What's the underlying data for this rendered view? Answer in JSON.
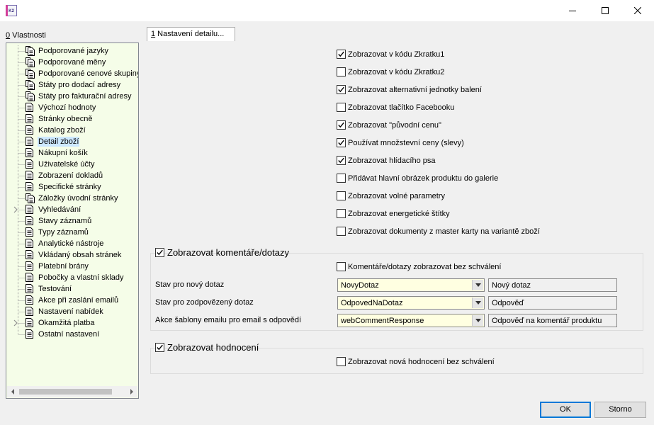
{
  "window": {
    "app_icon_text": "K2",
    "minimize_icon": "minimize-icon",
    "maximize_icon": "maximize-icon",
    "close_icon": "close-icon"
  },
  "left_panel": {
    "hotkey": "0",
    "title": " Vlastnosti",
    "items": [
      {
        "label": "Podporované jazyky",
        "icon": "multi-doc-icon",
        "expandable": false,
        "selected": false
      },
      {
        "label": "Podporované měny",
        "icon": "multi-doc-icon",
        "expandable": false,
        "selected": false
      },
      {
        "label": "Podporované cenové skupiny",
        "icon": "multi-doc-icon",
        "expandable": false,
        "selected": false
      },
      {
        "label": "Státy pro dodací adresy",
        "icon": "multi-doc-icon",
        "expandable": false,
        "selected": false
      },
      {
        "label": "Státy pro fakturační adresy",
        "icon": "multi-doc-icon",
        "expandable": false,
        "selected": false
      },
      {
        "label": "Výchozí hodnoty",
        "icon": "doc-icon",
        "expandable": false,
        "selected": false
      },
      {
        "label": "Stránky obecně",
        "icon": "doc-icon",
        "expandable": false,
        "selected": false
      },
      {
        "label": "Katalog zboží",
        "icon": "doc-icon",
        "expandable": false,
        "selected": false
      },
      {
        "label": "Detail zboží",
        "icon": "doc-icon",
        "expandable": false,
        "selected": true
      },
      {
        "label": "Nákupní košík",
        "icon": "doc-icon",
        "expandable": false,
        "selected": false
      },
      {
        "label": "Uživatelské účty",
        "icon": "doc-icon",
        "expandable": false,
        "selected": false
      },
      {
        "label": "Zobrazení dokladů",
        "icon": "doc-icon",
        "expandable": false,
        "selected": false
      },
      {
        "label": "Specifické stránky",
        "icon": "doc-icon",
        "expandable": false,
        "selected": false
      },
      {
        "label": "Záložky úvodní stránky",
        "icon": "multi-doc-icon",
        "expandable": false,
        "selected": false
      },
      {
        "label": "Vyhledávání",
        "icon": "doc-icon",
        "expandable": true,
        "selected": false
      },
      {
        "label": "Stavy záznamů",
        "icon": "doc-icon",
        "expandable": false,
        "selected": false
      },
      {
        "label": "Typy záznamů",
        "icon": "doc-icon",
        "expandable": false,
        "selected": false
      },
      {
        "label": "Analytické nástroje",
        "icon": "doc-icon",
        "expandable": false,
        "selected": false
      },
      {
        "label": "Vkládaný obsah stránek",
        "icon": "doc-icon",
        "expandable": false,
        "selected": false
      },
      {
        "label": "Platební brány",
        "icon": "doc-icon",
        "expandable": false,
        "selected": false
      },
      {
        "label": "Pobočky a vlastní sklady",
        "icon": "doc-icon",
        "expandable": false,
        "selected": false
      },
      {
        "label": "Testování",
        "icon": "doc-icon",
        "expandable": false,
        "selected": false
      },
      {
        "label": "Akce při zaslání emailů",
        "icon": "doc-icon",
        "expandable": false,
        "selected": false
      },
      {
        "label": "Nastavení nabídek",
        "icon": "doc-icon",
        "expandable": false,
        "selected": false
      },
      {
        "label": "Okamžitá platba",
        "icon": "doc-icon",
        "expandable": true,
        "selected": false
      },
      {
        "label": "Ostatní nastavení",
        "icon": "doc-icon",
        "expandable": false,
        "selected": false
      }
    ]
  },
  "tab": {
    "hotkey": "1",
    "label": " Nastavení detailu..."
  },
  "options": [
    {
      "label": "Zobrazovat v kódu Zkratku1",
      "checked": true
    },
    {
      "label": "Zobrazovat v kódu Zkratku2",
      "checked": false
    },
    {
      "label": "Zobrazovat alternativní jednotky balení",
      "checked": true
    },
    {
      "label": "Zobrazovat tlačítko Facebooku",
      "checked": false
    },
    {
      "label": "Zobrazovat \"původní cenu\"",
      "checked": true
    },
    {
      "label": "Používat množstevní ceny (slevy)",
      "checked": true
    },
    {
      "label": "Zobrazovat hlídacího psa",
      "checked": true
    },
    {
      "label": "Přidávat hlavní obrázek produktu do galerie",
      "checked": false
    },
    {
      "label": "Zobrazovat volné parametry",
      "checked": false
    },
    {
      "label": "Zobrazovat energetické štítky",
      "checked": false
    },
    {
      "label": "Zobrazovat dokumenty z master karty na variantě zboží",
      "checked": false
    }
  ],
  "comments_group": {
    "title": "Zobrazovat komentáře/dotazy",
    "checked": true,
    "without_approval": {
      "label": "Komentáře/dotazy zobrazovat bez schválení",
      "checked": false
    },
    "rows": [
      {
        "label": "Stav pro nový dotaz",
        "value": "NovyDotaz",
        "display": "Nový dotaz"
      },
      {
        "label": "Stav pro zodpovězený dotaz",
        "value": "OdpovedNaDotaz",
        "display": "Odpověď"
      },
      {
        "label": "Akce šablony emailu pro email s odpovědí",
        "value": "webCommentResponse",
        "display": "Odpověď na komentář produktu"
      }
    ]
  },
  "rating_group": {
    "title": "Zobrazovat hodnocení",
    "checked": true,
    "without_approval": {
      "label": "Zobrazovat nová hodnocení bez schválení",
      "checked": false
    }
  },
  "buttons": {
    "ok": "OK",
    "cancel": "Storno"
  }
}
